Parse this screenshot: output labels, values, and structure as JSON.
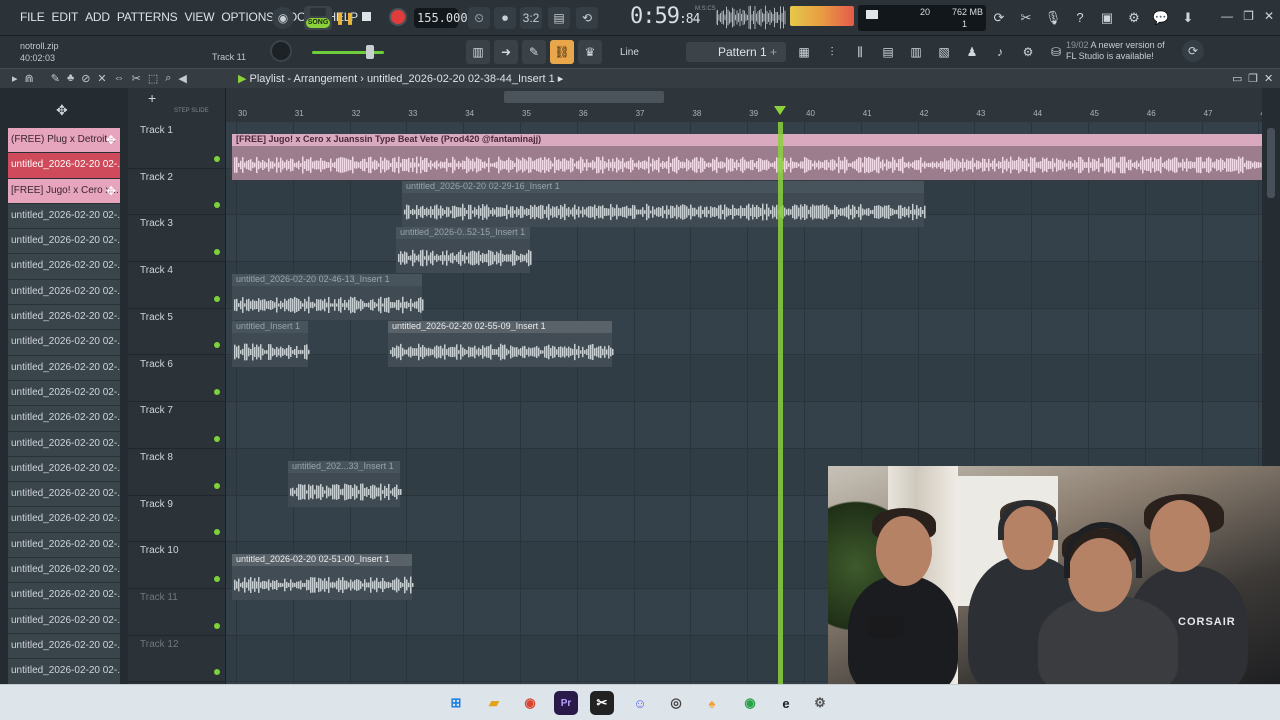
{
  "menu": [
    "FILE",
    "EDIT",
    "ADD",
    "PATTERNS",
    "VIEW",
    "OPTIONS",
    "TOOLS",
    "HELP"
  ],
  "transport": {
    "song_label": "SONG",
    "tempo": "155.000",
    "time_main": "0:59",
    "time_sub": ":84",
    "time_unit": "M:S:CS"
  },
  "cpu": {
    "value": "20",
    "ram": "762 MB",
    "poly": "1"
  },
  "hint": {
    "line1": "notroll.zip",
    "line2": "40:02:03",
    "track": "Track 11"
  },
  "snap": "Line",
  "pattern": "Pattern 1",
  "update": {
    "date": "19/02",
    "line1": "A newer version of",
    "line2": "FL Studio is available!"
  },
  "playlist": {
    "title": "Playlist - Arrangement",
    "separator": "›",
    "project": "untitled_2026-02-20 02-38-44_Insert 1"
  },
  "ruler": {
    "ticks": [
      "30",
      "31",
      "32",
      "33",
      "34",
      "35",
      "36",
      "37",
      "38",
      "39",
      "40",
      "41",
      "42",
      "43",
      "44",
      "45",
      "46",
      "47",
      "48"
    ]
  },
  "browser": {
    "step_slide": "STEP SLIDE",
    "items": [
      {
        "label": "(FREE) Plug x Detroit...",
        "style": "pink"
      },
      {
        "label": "untitled_2026-02-20 02-...",
        "style": "red"
      },
      {
        "label": "[FREE] Jugo! x Cero x...",
        "style": "pink"
      },
      {
        "label": "untitled_2026-02-20 02-...",
        "style": ""
      },
      {
        "label": "untitled_2026-02-20 02-...",
        "style": ""
      },
      {
        "label": "untitled_2026-02-20 02-...",
        "style": ""
      },
      {
        "label": "untitled_2026-02-20 02-...",
        "style": ""
      },
      {
        "label": "untitled_2026-02-20 02-...",
        "style": ""
      },
      {
        "label": "untitled_2026-02-20 02-...",
        "style": ""
      },
      {
        "label": "untitled_2026-02-20 02-...",
        "style": ""
      },
      {
        "label": "untitled_2026-02-20 02-...",
        "style": ""
      },
      {
        "label": "untitled_2026-02-20 02-...",
        "style": ""
      },
      {
        "label": "untitled_2026-02-20 02-...",
        "style": ""
      },
      {
        "label": "untitled_2026-02-20 02-...",
        "style": ""
      },
      {
        "label": "untitled_2026-02-20 02-...",
        "style": ""
      },
      {
        "label": "untitled_2026-02-20 02-...",
        "style": ""
      },
      {
        "label": "untitled_2026-02-20 02-...",
        "style": ""
      },
      {
        "label": "untitled_2026-02-20 02-...",
        "style": ""
      },
      {
        "label": "untitled_2026-02-20 02-...",
        "style": ""
      },
      {
        "label": "untitled_2026-02-20 02-...",
        "style": ""
      },
      {
        "label": "untitled_2026-02-20 02-...",
        "style": ""
      },
      {
        "label": "untitled_2026-02-20 02-...",
        "style": ""
      }
    ]
  },
  "tracks": [
    "Track 1",
    "Track 2",
    "Track 3",
    "Track 4",
    "Track 5",
    "Track 6",
    "Track 7",
    "Track 8",
    "Track 9",
    "Track 10",
    "Track 11",
    "Track 12"
  ],
  "clips": [
    {
      "track": 0,
      "label": "[FREE] Jugo! x Cero x Juanssin Type Beat Vete (Prod420 @fantaminajj)",
      "style": "pinky"
    },
    {
      "track": 1,
      "label": "untitled_2026-02-20 02-29-16_Insert 1",
      "style": ""
    },
    {
      "track": 2,
      "label": "untitled_2026-0..52-15_Insert 1",
      "style": ""
    },
    {
      "track": 3,
      "label": "untitled_2026-02-20 02-46-13_Insert 1",
      "style": ""
    },
    {
      "track": 4,
      "label": "untitled_Insert 1",
      "style": ""
    },
    {
      "track": 4,
      "label": "untitled_2026-02-20 02-55-09_Insert 1",
      "style": "hi"
    },
    {
      "track": 7,
      "label": "untitled_202...33_Insert 1",
      "style": ""
    },
    {
      "track": 9,
      "label": "untitled_2026-02-20 02-51-00_Insert 1",
      "style": "hi"
    }
  ],
  "webcam": {
    "brand": "CORSAIR"
  },
  "colors": {
    "accent": "#8bd13a",
    "playhead": "#8bd13a",
    "record": "#e23b3b"
  }
}
